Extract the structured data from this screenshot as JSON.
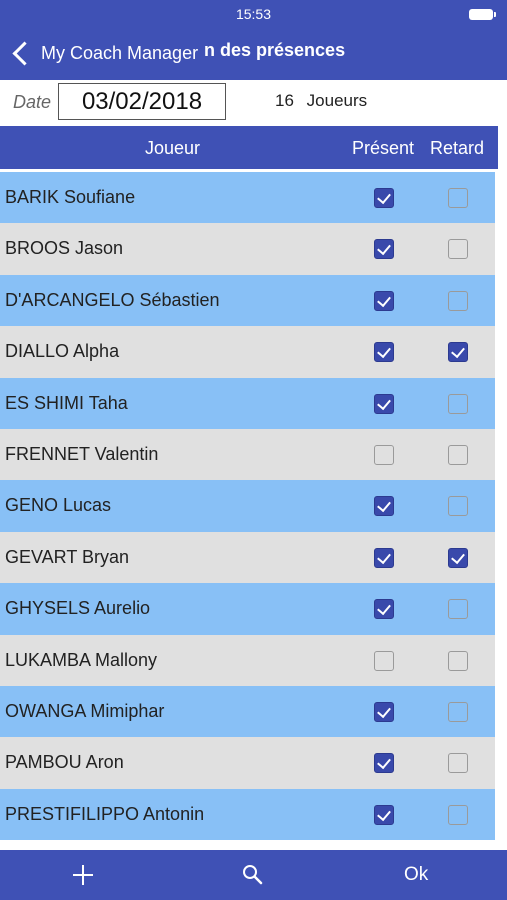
{
  "status": {
    "time": "15:53"
  },
  "nav": {
    "back_label": "My Coach Manager",
    "title": "n des présences"
  },
  "date": {
    "label": "Date",
    "value": "03/02/2018"
  },
  "count": {
    "number": "16",
    "label": "Joueurs"
  },
  "table": {
    "headers": {
      "player": "Joueur",
      "present": "Présent",
      "late": "Retard"
    },
    "rows": [
      {
        "name": "BARIK Soufiane",
        "present": true,
        "late": false
      },
      {
        "name": "BROOS Jason",
        "present": true,
        "late": false
      },
      {
        "name": "D'ARCANGELO Sébastien",
        "present": true,
        "late": false
      },
      {
        "name": "DIALLO Alpha",
        "present": true,
        "late": true
      },
      {
        "name": "ES SHIMI Taha",
        "present": true,
        "late": false
      },
      {
        "name": "FRENNET Valentin",
        "present": false,
        "late": false
      },
      {
        "name": "GENO Lucas",
        "present": true,
        "late": false
      },
      {
        "name": "GEVART Bryan",
        "present": true,
        "late": true
      },
      {
        "name": "GHYSELS Aurelio",
        "present": true,
        "late": false
      },
      {
        "name": "LUKAMBA Mallony",
        "present": false,
        "late": false
      },
      {
        "name": "OWANGA Mimiphar",
        "present": true,
        "late": false
      },
      {
        "name": "PAMBOU Aron",
        "present": true,
        "late": false
      },
      {
        "name": "PRESTIFILIPPO Antonin",
        "present": true,
        "late": false
      }
    ]
  },
  "bottom": {
    "add_icon": "plus-icon",
    "search_icon": "search-icon",
    "ok_label": "Ok"
  },
  "colors": {
    "primary": "#3f51b5",
    "row_blue": "#88c0f6",
    "row_grey": "#e0e0e0",
    "check": "#3949ab"
  }
}
